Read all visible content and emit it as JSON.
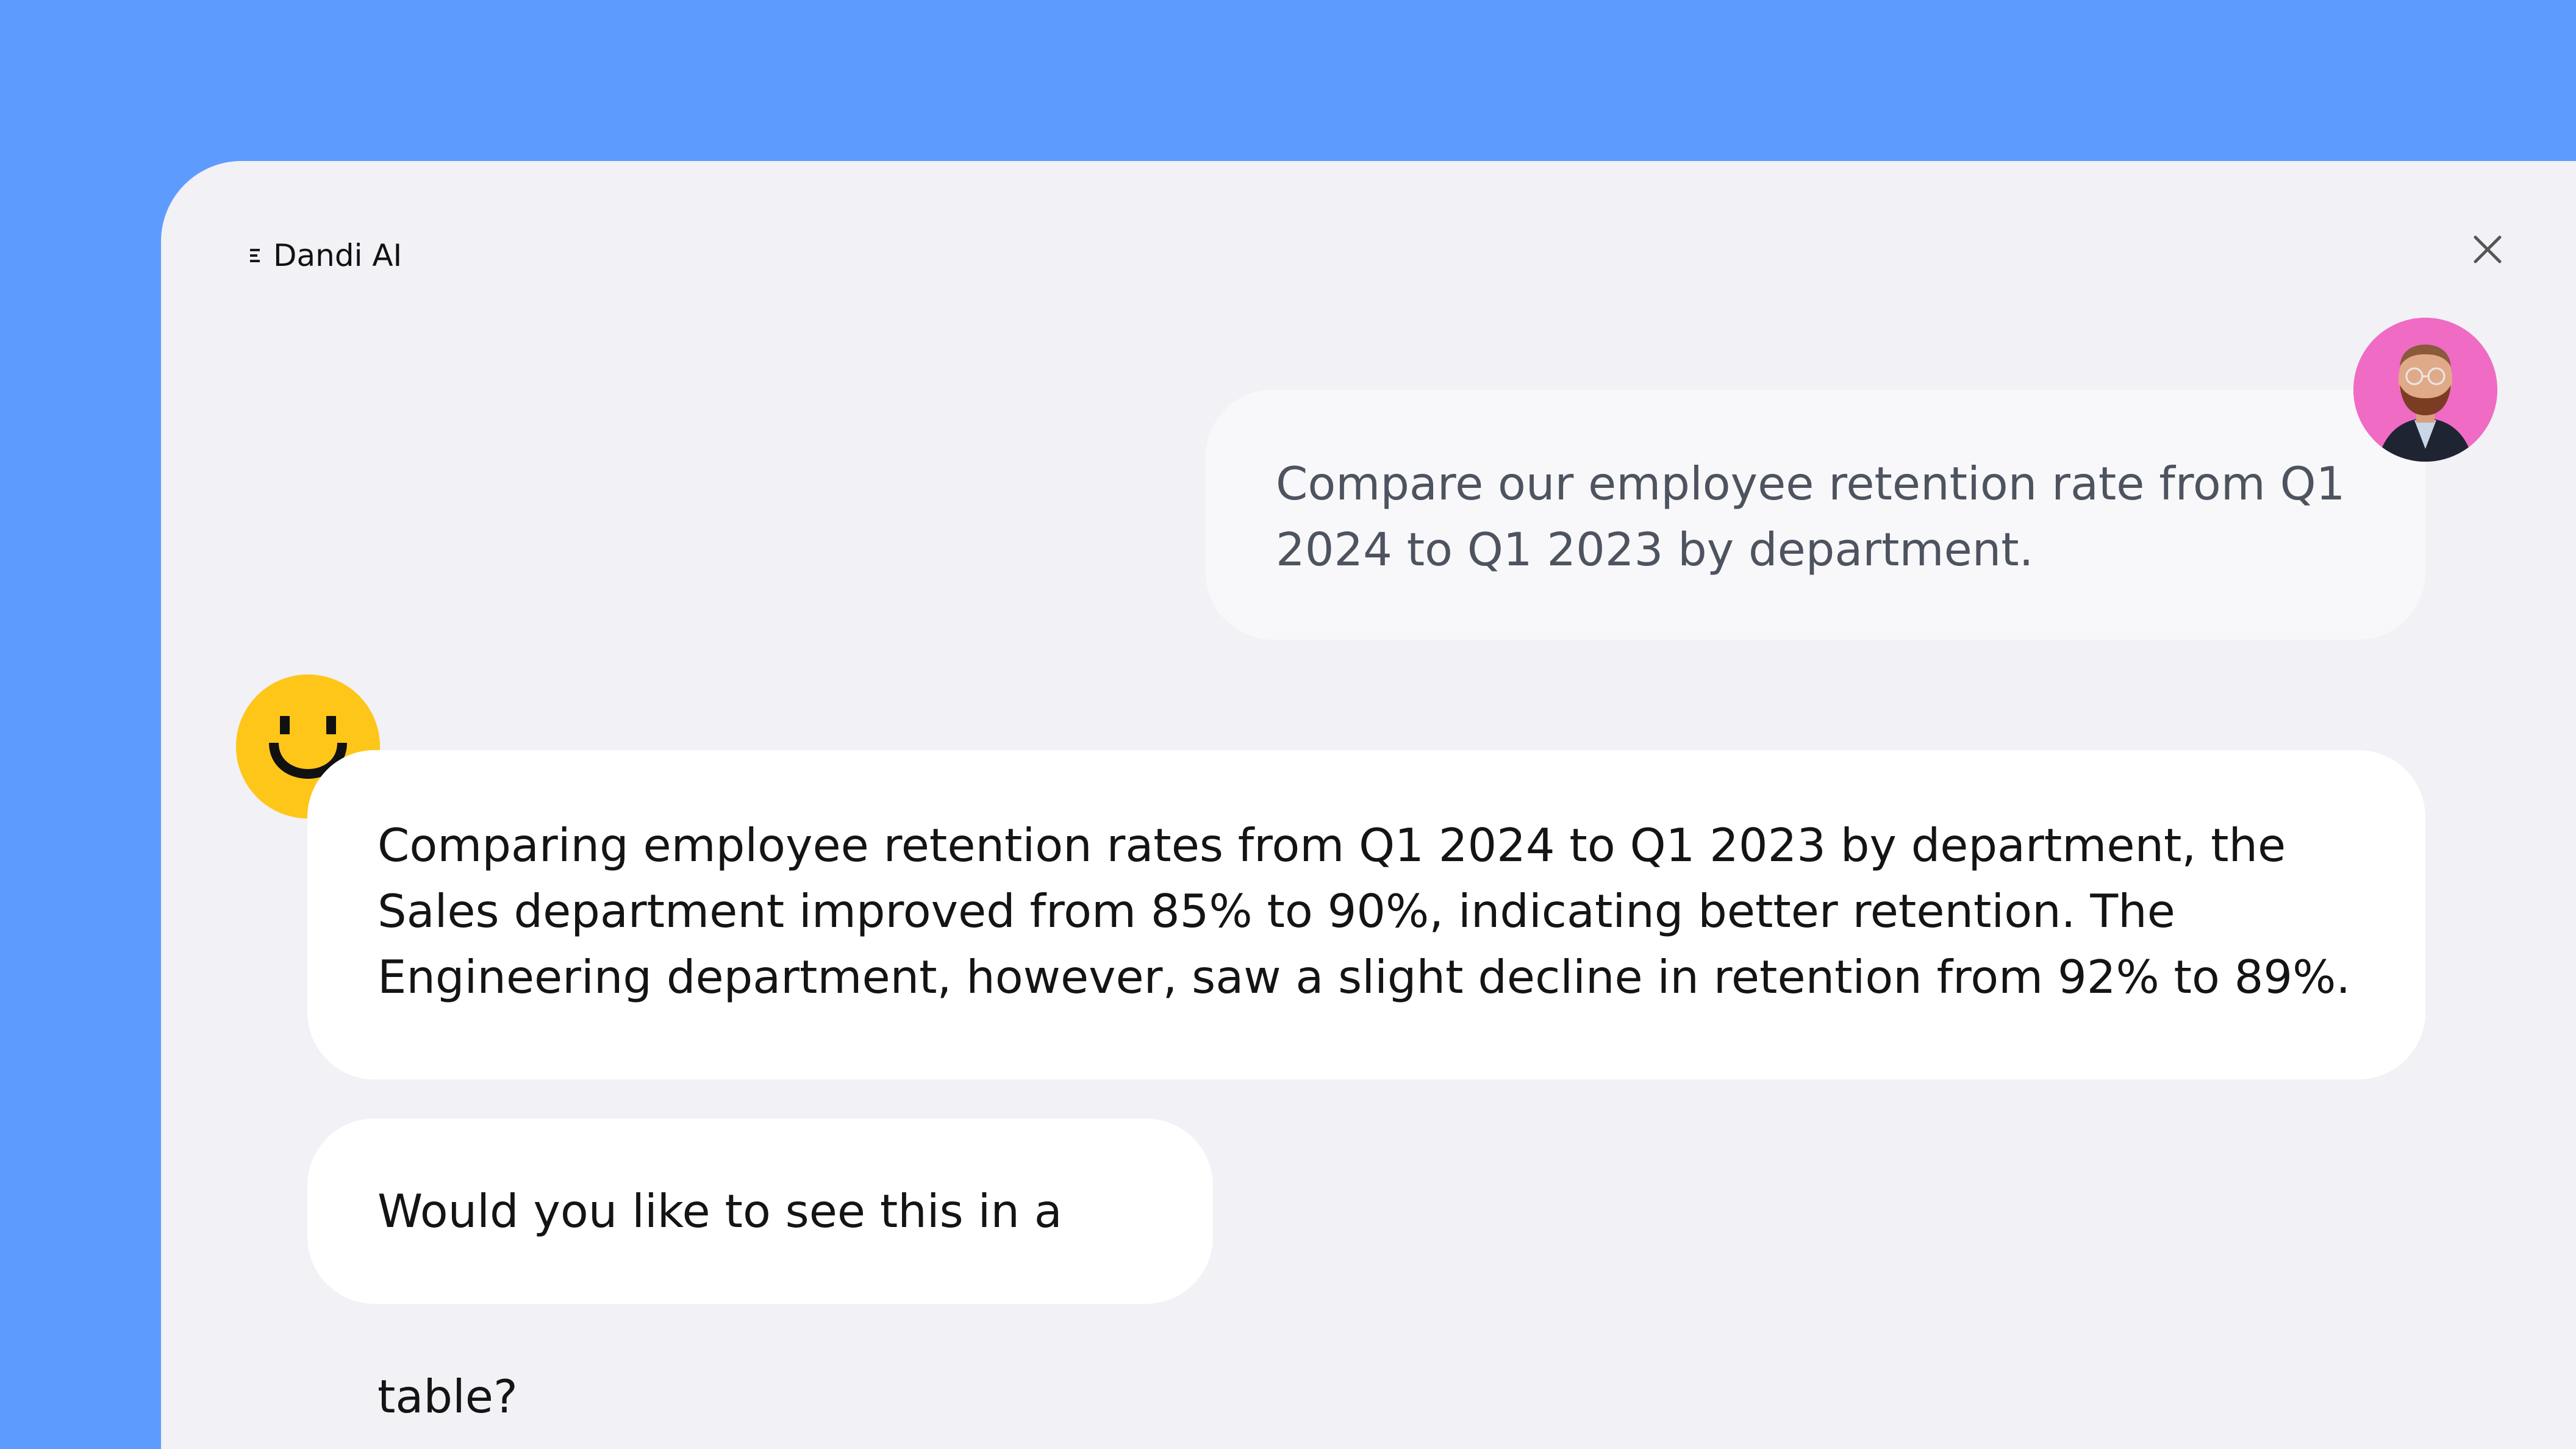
{
  "app": {
    "title": "Dandi AI"
  },
  "icons": {
    "menu": "menu-icon",
    "close": "close-icon",
    "user_avatar": "user-avatar",
    "assistant_avatar": "smiley-icon"
  },
  "colors": {
    "background": "#5e9bff",
    "panel": "#f1f1f6",
    "user_bubble": "#f8f8fa",
    "assistant_bubble": "#ffffff",
    "assistant_avatar": "#ffc61a",
    "user_avatar": "#f06bc4"
  },
  "conversation": {
    "user_message": "Compare our employee retention rate from Q1 2024 to Q1 2023 by department.",
    "assistant_message": "Comparing employee retention rates from Q1 2024 to Q1 2023 by department, the Sales department improved from 85% to 90%, indicating better retention. The Engineering department, however, saw a slight decline in retention from 92% to 89%.",
    "assistant_followup": "Would you like to see this in a table?"
  }
}
